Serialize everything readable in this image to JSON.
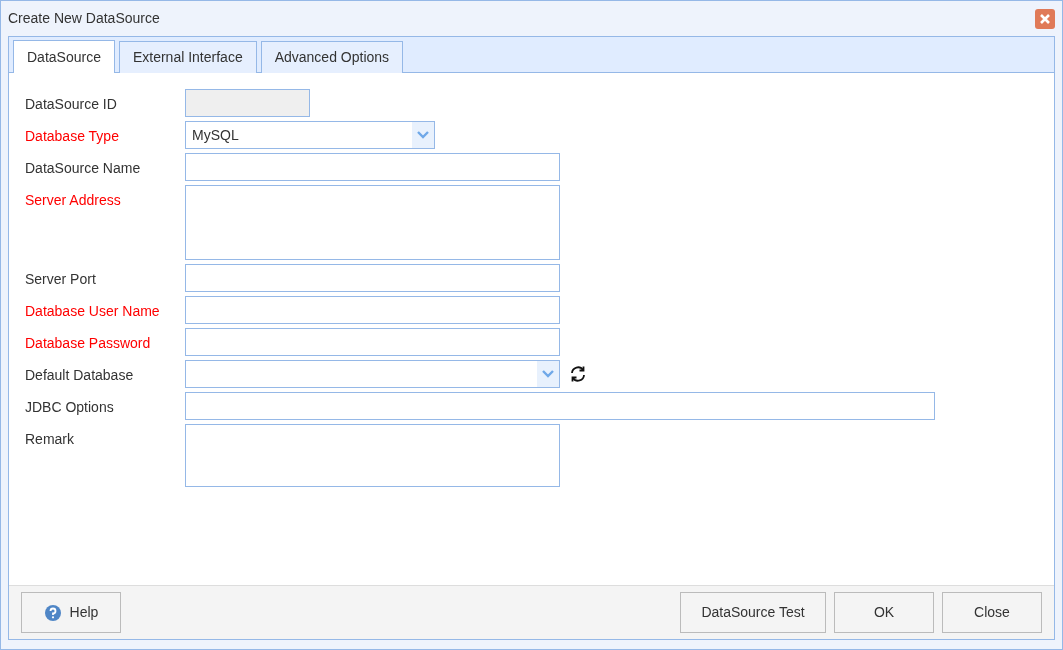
{
  "window": {
    "title": "Create New DataSource"
  },
  "tabs": [
    {
      "label": "DataSource",
      "selected": true
    },
    {
      "label": "External Interface",
      "selected": false
    },
    {
      "label": "Advanced Options",
      "selected": false
    }
  ],
  "fields": [
    {
      "label": "DataSource ID",
      "kind": "idfield",
      "required": false,
      "disabled": true
    },
    {
      "label": "Database Type",
      "kind": "typeselect",
      "required": true,
      "disabled": false,
      "value": "MySQL"
    },
    {
      "label": "DataSource Name",
      "kind": "text",
      "required": false,
      "disabled": false
    },
    {
      "label": "Server Address",
      "kind": "textarea",
      "required": true,
      "disabled": false
    },
    {
      "label": "Server Port",
      "kind": "text",
      "required": false,
      "disabled": false
    },
    {
      "label": "Database User Name",
      "kind": "text",
      "required": true,
      "disabled": false
    },
    {
      "label": "Database Password",
      "kind": "text",
      "required": true,
      "disabled": false
    },
    {
      "label": "Default Database",
      "kind": "select",
      "required": false,
      "disabled": false,
      "refresh": true
    },
    {
      "label": "JDBC Options",
      "kind": "widetext",
      "required": false,
      "disabled": false
    },
    {
      "label": "Remark",
      "kind": "remark",
      "required": false,
      "disabled": false
    }
  ],
  "footer": {
    "help": "Help",
    "buttons": [
      "DataSource Test",
      "OK",
      "Close"
    ]
  }
}
